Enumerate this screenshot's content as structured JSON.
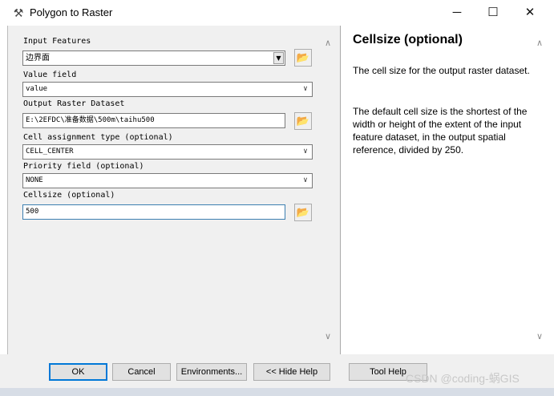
{
  "window": {
    "title": "Polygon to Raster",
    "minimize": "─",
    "maximize": "☐",
    "close": "✕"
  },
  "form": {
    "input_features": {
      "label": "Input Features",
      "value": "边界面"
    },
    "value_field": {
      "label": "Value field",
      "value": "value"
    },
    "output_raster": {
      "label": "Output Raster Dataset",
      "value": "E:\\2EFDC\\准备数据\\500m\\taihu500"
    },
    "cell_assignment": {
      "label": "Cell assignment type (optional)",
      "value": "CELL_CENTER"
    },
    "priority_field": {
      "label": "Priority field (optional)",
      "value": "NONE"
    },
    "cellsize": {
      "label": "Cellsize (optional)",
      "value": "500"
    }
  },
  "help": {
    "title": "Cellsize (optional)",
    "para1": "The cell size for the output raster dataset.",
    "para2": "The default cell size is the shortest of the width or height of the extent of the input feature dataset, in the output spatial reference, divided by 250."
  },
  "buttons": {
    "ok": "OK",
    "cancel": "Cancel",
    "environments": "Environments...",
    "hide_help": "<< Hide Help",
    "tool_help": "Tool Help"
  },
  "watermark": "CSDN @coding-蜗GIS"
}
